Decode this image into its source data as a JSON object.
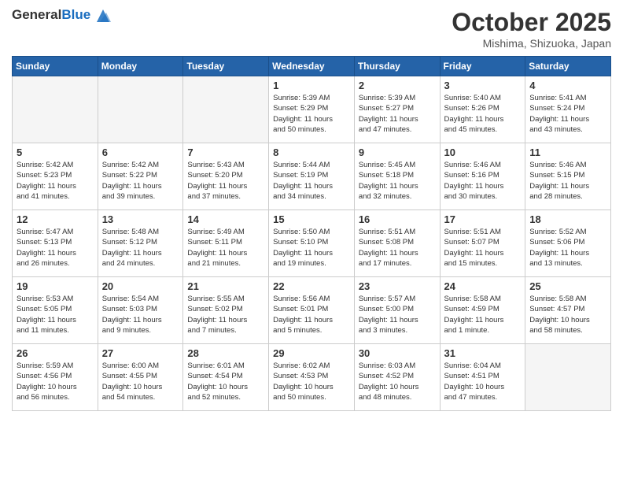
{
  "header": {
    "logo_general": "General",
    "logo_blue": "Blue",
    "month_title": "October 2025",
    "location": "Mishima, Shizuoka, Japan"
  },
  "weekdays": [
    "Sunday",
    "Monday",
    "Tuesday",
    "Wednesday",
    "Thursday",
    "Friday",
    "Saturday"
  ],
  "weeks": [
    [
      {
        "day": "",
        "info": ""
      },
      {
        "day": "",
        "info": ""
      },
      {
        "day": "",
        "info": ""
      },
      {
        "day": "1",
        "info": "Sunrise: 5:39 AM\nSunset: 5:29 PM\nDaylight: 11 hours\nand 50 minutes."
      },
      {
        "day": "2",
        "info": "Sunrise: 5:39 AM\nSunset: 5:27 PM\nDaylight: 11 hours\nand 47 minutes."
      },
      {
        "day": "3",
        "info": "Sunrise: 5:40 AM\nSunset: 5:26 PM\nDaylight: 11 hours\nand 45 minutes."
      },
      {
        "day": "4",
        "info": "Sunrise: 5:41 AM\nSunset: 5:24 PM\nDaylight: 11 hours\nand 43 minutes."
      }
    ],
    [
      {
        "day": "5",
        "info": "Sunrise: 5:42 AM\nSunset: 5:23 PM\nDaylight: 11 hours\nand 41 minutes."
      },
      {
        "day": "6",
        "info": "Sunrise: 5:42 AM\nSunset: 5:22 PM\nDaylight: 11 hours\nand 39 minutes."
      },
      {
        "day": "7",
        "info": "Sunrise: 5:43 AM\nSunset: 5:20 PM\nDaylight: 11 hours\nand 37 minutes."
      },
      {
        "day": "8",
        "info": "Sunrise: 5:44 AM\nSunset: 5:19 PM\nDaylight: 11 hours\nand 34 minutes."
      },
      {
        "day": "9",
        "info": "Sunrise: 5:45 AM\nSunset: 5:18 PM\nDaylight: 11 hours\nand 32 minutes."
      },
      {
        "day": "10",
        "info": "Sunrise: 5:46 AM\nSunset: 5:16 PM\nDaylight: 11 hours\nand 30 minutes."
      },
      {
        "day": "11",
        "info": "Sunrise: 5:46 AM\nSunset: 5:15 PM\nDaylight: 11 hours\nand 28 minutes."
      }
    ],
    [
      {
        "day": "12",
        "info": "Sunrise: 5:47 AM\nSunset: 5:13 PM\nDaylight: 11 hours\nand 26 minutes."
      },
      {
        "day": "13",
        "info": "Sunrise: 5:48 AM\nSunset: 5:12 PM\nDaylight: 11 hours\nand 24 minutes."
      },
      {
        "day": "14",
        "info": "Sunrise: 5:49 AM\nSunset: 5:11 PM\nDaylight: 11 hours\nand 21 minutes."
      },
      {
        "day": "15",
        "info": "Sunrise: 5:50 AM\nSunset: 5:10 PM\nDaylight: 11 hours\nand 19 minutes."
      },
      {
        "day": "16",
        "info": "Sunrise: 5:51 AM\nSunset: 5:08 PM\nDaylight: 11 hours\nand 17 minutes."
      },
      {
        "day": "17",
        "info": "Sunrise: 5:51 AM\nSunset: 5:07 PM\nDaylight: 11 hours\nand 15 minutes."
      },
      {
        "day": "18",
        "info": "Sunrise: 5:52 AM\nSunset: 5:06 PM\nDaylight: 11 hours\nand 13 minutes."
      }
    ],
    [
      {
        "day": "19",
        "info": "Sunrise: 5:53 AM\nSunset: 5:05 PM\nDaylight: 11 hours\nand 11 minutes."
      },
      {
        "day": "20",
        "info": "Sunrise: 5:54 AM\nSunset: 5:03 PM\nDaylight: 11 hours\nand 9 minutes."
      },
      {
        "day": "21",
        "info": "Sunrise: 5:55 AM\nSunset: 5:02 PM\nDaylight: 11 hours\nand 7 minutes."
      },
      {
        "day": "22",
        "info": "Sunrise: 5:56 AM\nSunset: 5:01 PM\nDaylight: 11 hours\nand 5 minutes."
      },
      {
        "day": "23",
        "info": "Sunrise: 5:57 AM\nSunset: 5:00 PM\nDaylight: 11 hours\nand 3 minutes."
      },
      {
        "day": "24",
        "info": "Sunrise: 5:58 AM\nSunset: 4:59 PM\nDaylight: 11 hours\nand 1 minute."
      },
      {
        "day": "25",
        "info": "Sunrise: 5:58 AM\nSunset: 4:57 PM\nDaylight: 10 hours\nand 58 minutes."
      }
    ],
    [
      {
        "day": "26",
        "info": "Sunrise: 5:59 AM\nSunset: 4:56 PM\nDaylight: 10 hours\nand 56 minutes."
      },
      {
        "day": "27",
        "info": "Sunrise: 6:00 AM\nSunset: 4:55 PM\nDaylight: 10 hours\nand 54 minutes."
      },
      {
        "day": "28",
        "info": "Sunrise: 6:01 AM\nSunset: 4:54 PM\nDaylight: 10 hours\nand 52 minutes."
      },
      {
        "day": "29",
        "info": "Sunrise: 6:02 AM\nSunset: 4:53 PM\nDaylight: 10 hours\nand 50 minutes."
      },
      {
        "day": "30",
        "info": "Sunrise: 6:03 AM\nSunset: 4:52 PM\nDaylight: 10 hours\nand 48 minutes."
      },
      {
        "day": "31",
        "info": "Sunrise: 6:04 AM\nSunset: 4:51 PM\nDaylight: 10 hours\nand 47 minutes."
      },
      {
        "day": "",
        "info": ""
      }
    ]
  ]
}
